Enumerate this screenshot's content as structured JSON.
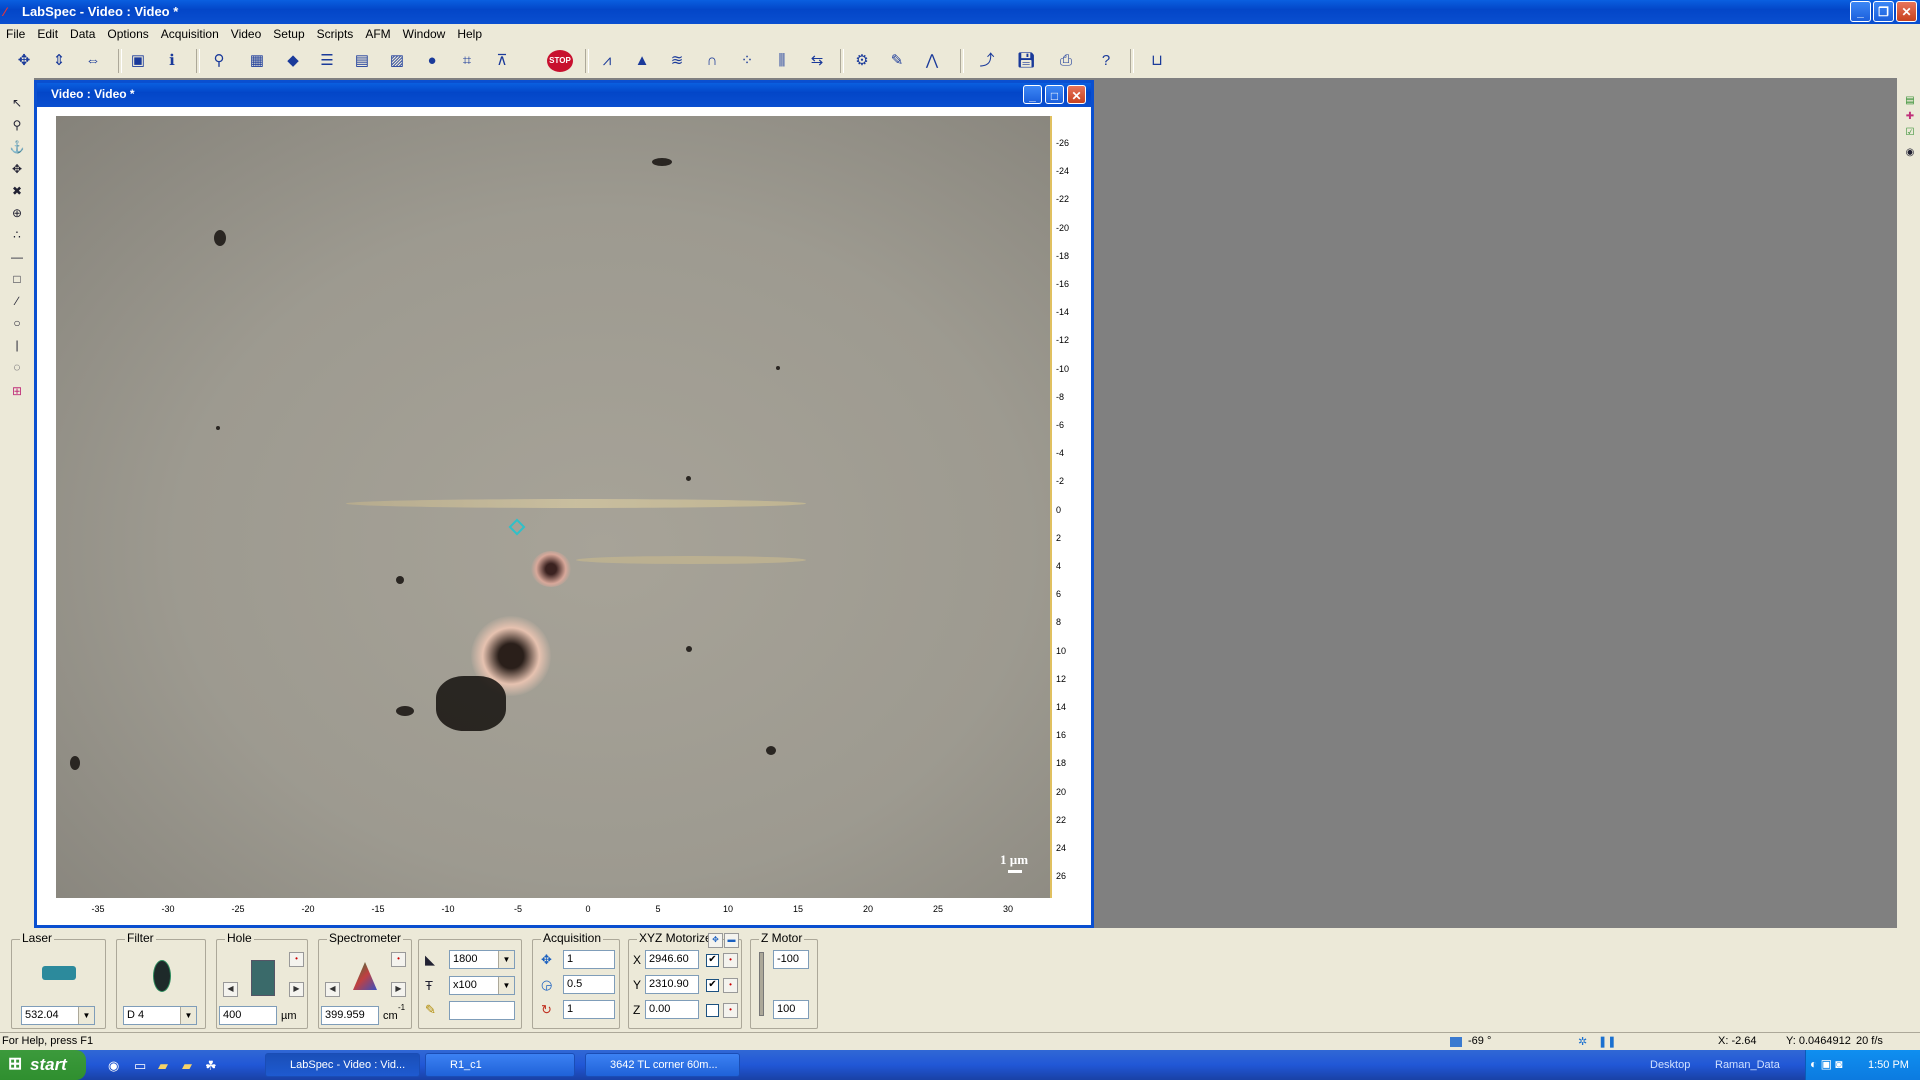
{
  "window": {
    "title": "LabSpec - Video : Video *"
  },
  "menu": [
    "File",
    "Edit",
    "Data",
    "Options",
    "Acquisition",
    "Video",
    "Setup",
    "Scripts",
    "AFM",
    "Window",
    "Help"
  ],
  "toolbar": {
    "stop_label": "STOP"
  },
  "video_window": {
    "title": "Video : Video *",
    "scale_bar_label": "1 µm",
    "y_ticks": [
      "-26",
      "-24",
      "-22",
      "-20",
      "-18",
      "-16",
      "-14",
      "-12",
      "-10",
      "-8",
      "-6",
      "-4",
      "-2",
      "0",
      "2",
      "4",
      "6",
      "8",
      "10",
      "12",
      "14",
      "16",
      "18",
      "20",
      "22",
      "24",
      "26"
    ],
    "x_ticks": [
      "-35",
      "-30",
      "-25",
      "-20",
      "-15",
      "-10",
      "-5",
      "0",
      "5",
      "10",
      "15",
      "20",
      "25",
      "30"
    ]
  },
  "panel": {
    "laser": {
      "label": "Laser",
      "value": "532.04"
    },
    "filter": {
      "label": "Filter",
      "value": "D 4"
    },
    "hole": {
      "label": "Hole",
      "value": "400",
      "unit": "µm"
    },
    "spectrometer": {
      "label": "Spectrometer",
      "value": "399.959",
      "unit": "cm",
      "unit_sup": "-1"
    },
    "grating": {
      "value": "1800"
    },
    "objective": {
      "value": "x100"
    },
    "extra": {
      "value": ""
    },
    "acquisition": {
      "label": "Acquisition",
      "time": "1",
      "dt": "0.5",
      "accum": "1"
    },
    "xyz": {
      "label": "XYZ Motorized",
      "x_label": "X",
      "x": "2946.60",
      "y_label": "Y",
      "y": "2310.90",
      "z_label": "Z",
      "z": "0.00"
    },
    "zmotor": {
      "label": "Z Motor",
      "top": "-100",
      "bottom": "100"
    }
  },
  "status": {
    "help": "For Help, press F1",
    "temp": "-69 °",
    "x": "X: -2.64",
    "y": "Y: 0.0464912",
    "fps": "20 f/s"
  },
  "taskbar": {
    "start": "start",
    "tasks": [
      "LabSpec - Video : Vid...",
      "R1_c1",
      "3642 TL corner 60m..."
    ],
    "desktop": "Desktop",
    "raman": "Raman_Data",
    "clock": "1:50 PM"
  },
  "colors": {
    "titlebar": "#0a4fd0",
    "taskbar": "#2157d6",
    "start": "#3c9a3c"
  }
}
